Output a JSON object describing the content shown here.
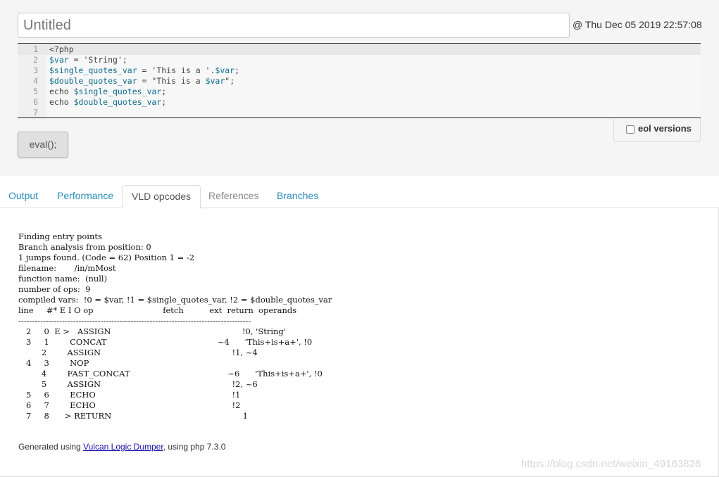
{
  "header": {
    "title_placeholder": "Untitled",
    "timestamp": "@ Thu Dec 05 2019 22:57:08"
  },
  "editor": {
    "lines": [
      {
        "num": "1",
        "code": "<?php"
      },
      {
        "num": "2",
        "code": "$var = 'String';"
      },
      {
        "num": "3",
        "code": "$single_quotes_var = 'This is a '.$var;"
      },
      {
        "num": "4",
        "code": "$double_quotes_var = \"This is a $var\";"
      },
      {
        "num": "5",
        "code": "echo $single_quotes_var;"
      },
      {
        "num": "6",
        "code": "echo $double_quotes_var;"
      },
      {
        "num": "7",
        "code": ""
      }
    ]
  },
  "eol": {
    "label": "eol versions",
    "checked": false
  },
  "eval_button": {
    "label": "eval();"
  },
  "tabs": [
    {
      "label": "Output",
      "active": false
    },
    {
      "label": "Performance",
      "active": false
    },
    {
      "label": "VLD opcodes",
      "active": true
    },
    {
      "label": "References",
      "active": false
    },
    {
      "label": "Branches",
      "active": false
    }
  ],
  "vld": {
    "lines": [
      "Finding entry points",
      "Branch analysis from position: 0",
      "1 jumps found. (Code = 62) Position 1 = -2",
      "filename:       /in/mMost",
      "function name:  (null)",
      "number of ops:  9",
      "compiled vars:  !0 = $var, !1 = $single_quotes_var, !2 = $double_quotes_var",
      "line     #* E I O op                           fetch          ext  return  operands",
      "-------------------------------------------------------------------------------------",
      "   2     0  E >   ASSIGN                                                   !0, 'String'",
      "   3     1        CONCAT                                           ~4      'This+is+a+', !0",
      "         2        ASSIGN                                                   !1, ~4",
      "   4     3        NOP",
      "         4        FAST_CONCAT                                      ~6      'This+is+a+', !0",
      "         5        ASSIGN                                                   !2, ~6",
      "   5     6        ECHO                                                     !1",
      "   6     7        ECHO                                                     !2",
      "   7     8      > RETURN                                                   1"
    ]
  },
  "footer": {
    "prefix": "Generated using ",
    "link_text": "Vulcan Logic Dumper",
    "suffix": ", using php 7.3.0"
  },
  "watermark": "https://blog.csdn.net/weixin_49163826"
}
